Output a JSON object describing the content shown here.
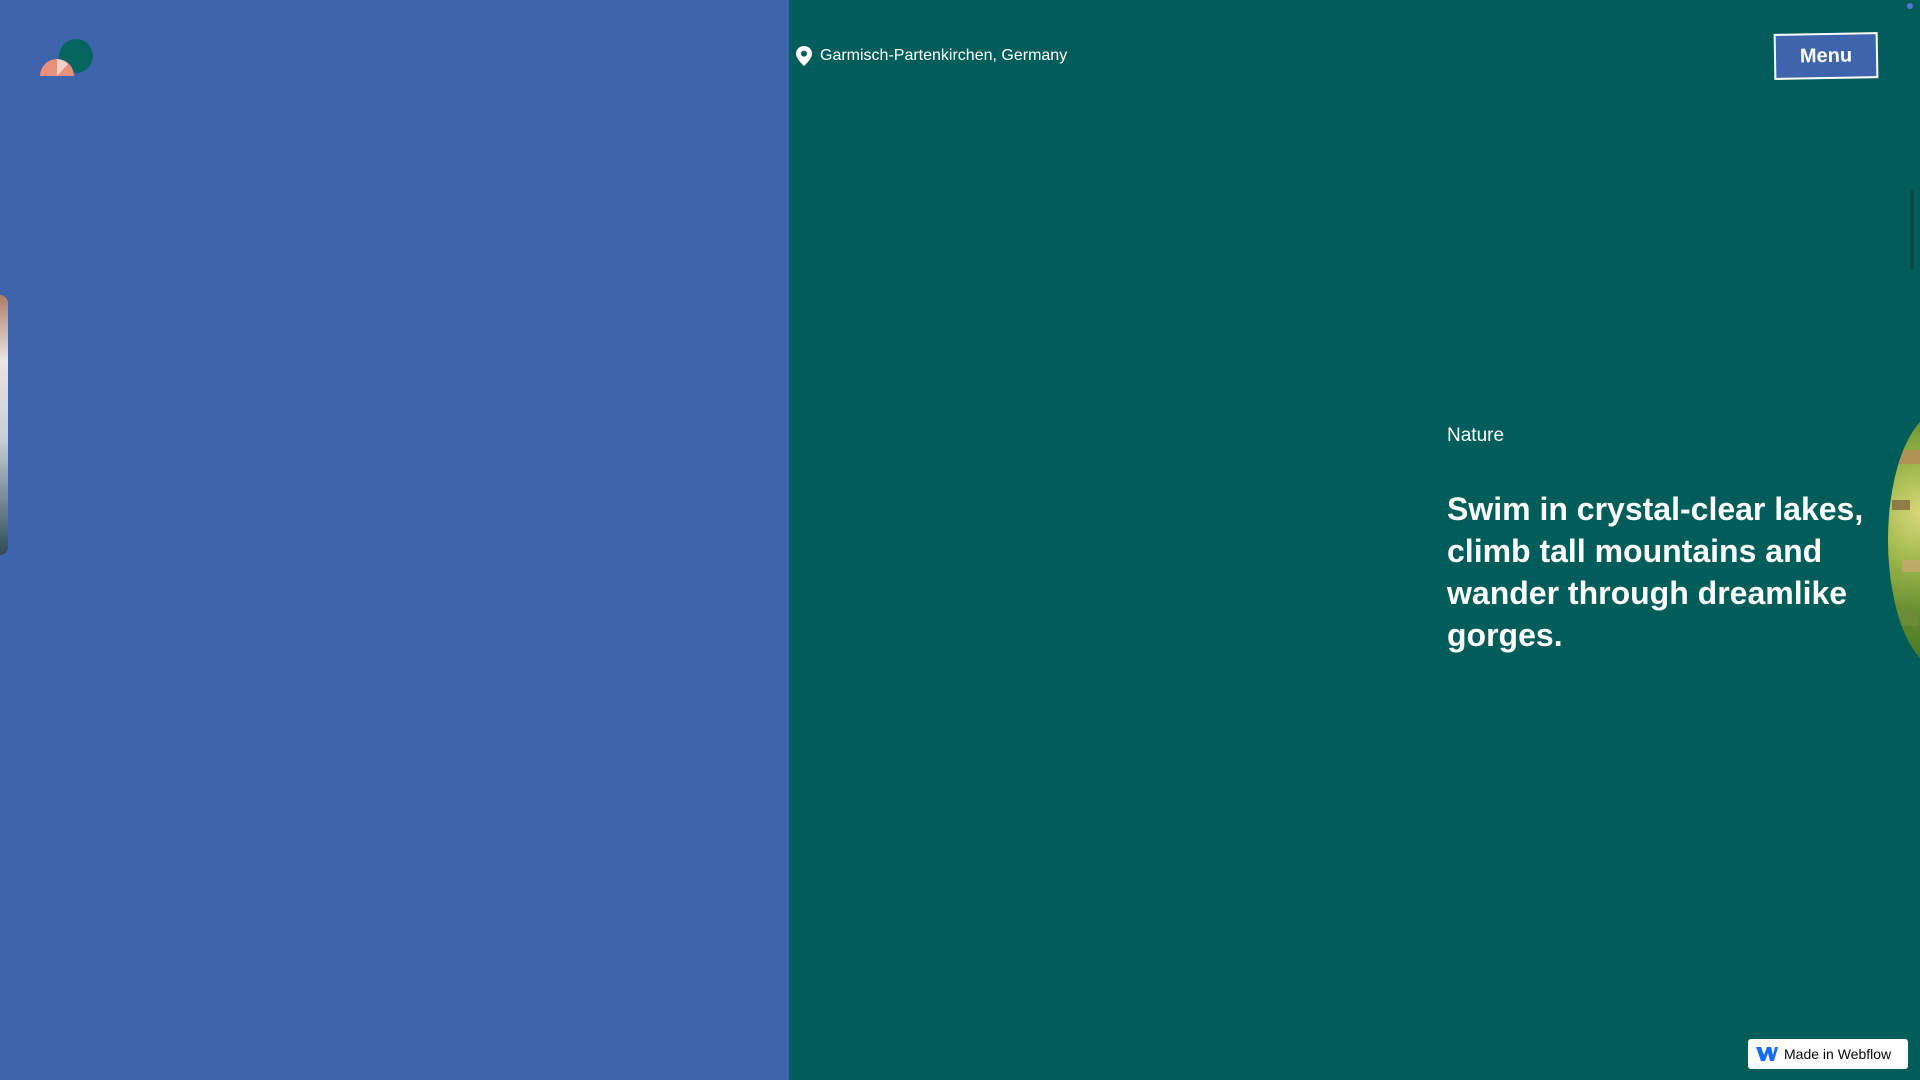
{
  "location": {
    "icon": "map-pin-icon",
    "text": "Garmisch-Partenkirchen, Germany"
  },
  "nav": {
    "menu_label": "Menu"
  },
  "feature": {
    "category": "Nature",
    "headline": "Swim in crystal-clear lakes, climb tall mountains and wander through dreamlike gorges."
  },
  "badge": {
    "icon": "webflow-logo-icon",
    "label": "Made in Webflow"
  },
  "colors": {
    "left_panel": "#3e64ad",
    "right_panel": "#005d5a",
    "logo_salmon": "#e9907c",
    "logo_teal": "#06665f",
    "webflow_blue": "#146ef5"
  }
}
